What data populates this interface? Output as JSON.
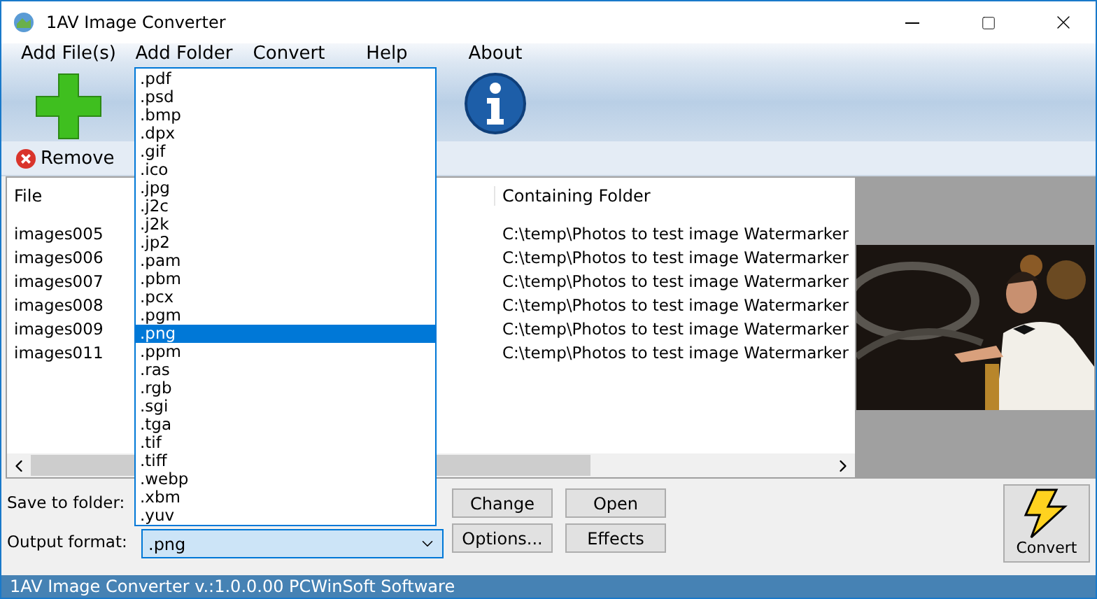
{
  "window": {
    "title": "1AV Image Converter"
  },
  "toolbar": [
    {
      "label": "Add File(s)",
      "kind": "plus"
    },
    {
      "label": "Add Folder",
      "kind": "hidden"
    },
    {
      "label": "Convert",
      "kind": "hidden"
    },
    {
      "label": "Help",
      "kind": "hidden"
    },
    {
      "label": "About",
      "kind": "info"
    }
  ],
  "remove_button": "Remove",
  "table": {
    "columns": [
      "File",
      "Containing Folder"
    ],
    "rows": [
      {
        "file": "images005",
        "folder": "C:\\temp\\Photos to test image Watermarker"
      },
      {
        "file": "images006",
        "folder": "C:\\temp\\Photos to test image Watermarker"
      },
      {
        "file": "images007",
        "folder": "C:\\temp\\Photos to test image Watermarker"
      },
      {
        "file": "images008",
        "folder": "C:\\temp\\Photos to test image Watermarker"
      },
      {
        "file": "images009",
        "folder": "C:\\temp\\Photos to test image Watermarker"
      },
      {
        "file": "images011",
        "folder": "C:\\temp\\Photos to test image Watermarker"
      }
    ]
  },
  "preview": {
    "kind": "picture"
  },
  "save_label": "Save to folder:",
  "format_label": "Output format:",
  "format_value": ".png",
  "buttons": [
    "Change",
    "Open",
    "Options...",
    "Effects"
  ],
  "convert_button": "Convert",
  "dropdown": [
    {
      "label": ".pdf",
      "selected": false
    },
    {
      "label": ".psd",
      "selected": false
    },
    {
      "label": ".bmp",
      "selected": false
    },
    {
      "label": ".dpx",
      "selected": false
    },
    {
      "label": ".gif",
      "selected": false
    },
    {
      "label": ".ico",
      "selected": false
    },
    {
      "label": ".jpg",
      "selected": false
    },
    {
      "label": ".j2c",
      "selected": false
    },
    {
      "label": ".j2k",
      "selected": false
    },
    {
      "label": ".jp2",
      "selected": false
    },
    {
      "label": ".pam",
      "selected": false
    },
    {
      "label": ".pbm",
      "selected": false
    },
    {
      "label": ".pcx",
      "selected": false
    },
    {
      "label": ".pgm",
      "selected": false
    },
    {
      "label": ".png",
      "selected": true
    },
    {
      "label": ".ppm",
      "selected": false
    },
    {
      "label": ".ras",
      "selected": false
    },
    {
      "label": ".rgb",
      "selected": false
    },
    {
      "label": ".sgi",
      "selected": false
    },
    {
      "label": ".tga",
      "selected": false
    },
    {
      "label": ".tif",
      "selected": false
    },
    {
      "label": ".tiff",
      "selected": false
    },
    {
      "label": ".webp",
      "selected": false
    },
    {
      "label": ".xbm",
      "selected": false
    },
    {
      "label": ".yuv",
      "selected": false
    }
  ],
  "status_bar": "1AV Image Converter v.:1.0.0.00 PCWinSoft Software"
}
